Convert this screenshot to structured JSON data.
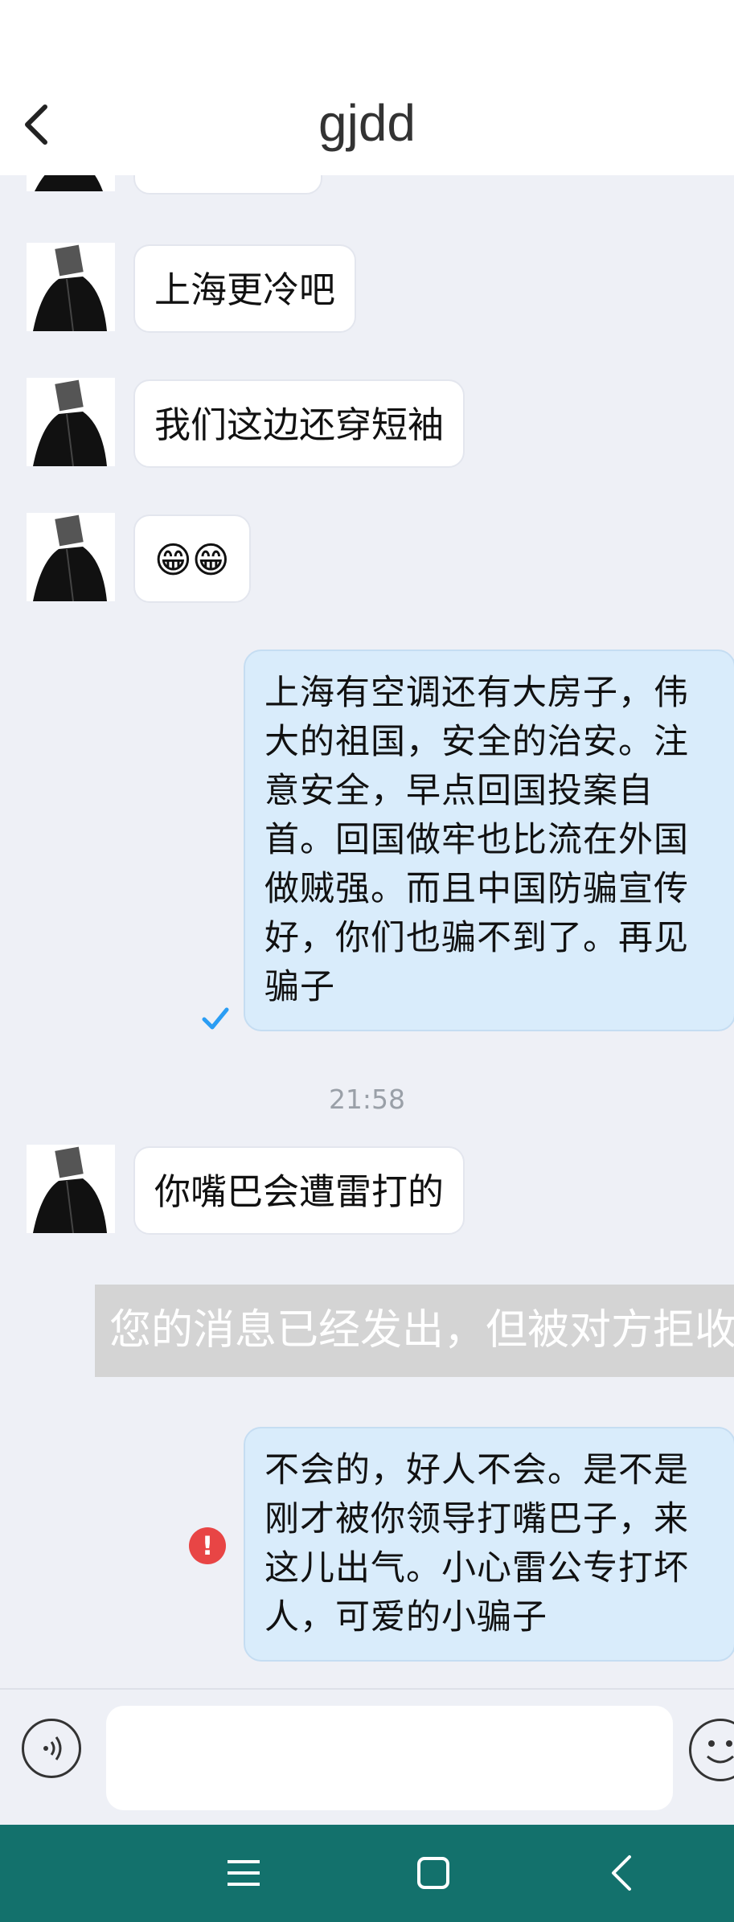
{
  "header": {
    "title": "gjdd",
    "back_icon": "chevron-left-icon"
  },
  "messages": [
    {
      "type": "incoming",
      "text": "上海更冷吧"
    },
    {
      "type": "incoming",
      "text": "我们这边还穿短袖"
    },
    {
      "type": "incoming",
      "text": "😁😁"
    },
    {
      "type": "outgoing",
      "text": "上海有空调还有大房子，伟大的祖国，安全的治安。注意安全，早点回国投案自首。回国做牢也比流在外国做贼强。而且中国防骗宣传好，你们也骗不到了。再见骗子",
      "status": "sent"
    },
    {
      "type": "timestamp",
      "text": "21:58"
    },
    {
      "type": "incoming",
      "text": "你嘴巴会遭雷打的"
    },
    {
      "type": "system",
      "text": "您的消息已经发出，但被对方拒收了"
    },
    {
      "type": "outgoing",
      "text": "不会的，好人不会。是不是刚才被你领导打嘴巴子，来这儿出气。小心雷公专打坏人，可爱的小骗子",
      "status": "failed",
      "status_icon": "!"
    }
  ],
  "input_bar": {
    "voice_icon": "voice-icon",
    "input_value": "",
    "emoji_icon": "emoji-icon"
  },
  "nav_bar": {
    "icons": [
      "menu-icon",
      "home-icon",
      "back-icon"
    ]
  },
  "colors": {
    "outgoing_bubble": "#d9ecfb",
    "incoming_bubble": "#ffffff",
    "nav_bar": "#13716c",
    "error": "#e84545",
    "check": "#2a9df4"
  }
}
